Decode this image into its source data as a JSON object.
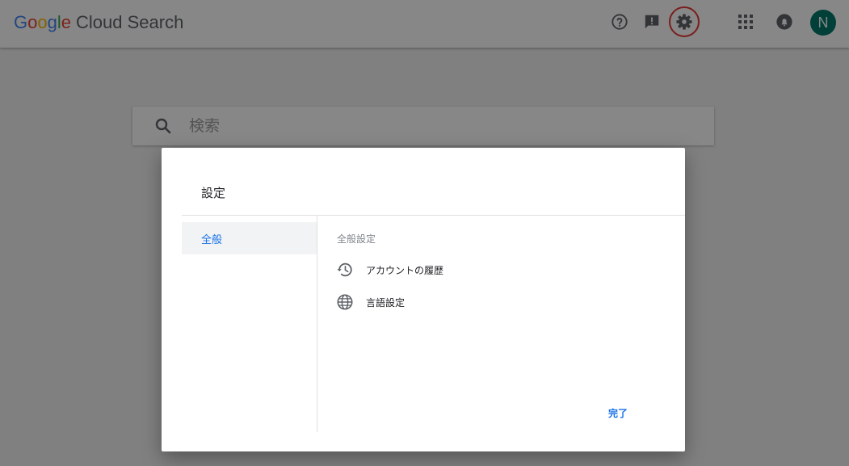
{
  "header": {
    "logo_letters": [
      {
        "char": "G",
        "color": "#4285F4"
      },
      {
        "char": "o",
        "color": "#EA4335"
      },
      {
        "char": "o",
        "color": "#FBBC05"
      },
      {
        "char": "g",
        "color": "#4285F4"
      },
      {
        "char": "l",
        "color": "#34A853"
      },
      {
        "char": "e",
        "color": "#EA4335"
      }
    ],
    "product_name": "Cloud Search",
    "icons": [
      "help-icon",
      "feedback-icon",
      "settings-icon",
      "apps-grid-icon",
      "notifications-icon"
    ],
    "avatar_letter": "N",
    "avatar_color": "#00796b",
    "highlight_color": "#e53935"
  },
  "search": {
    "placeholder": "検索"
  },
  "dialog": {
    "title": "設定",
    "nav_items": [
      {
        "label": "全般",
        "selected": true
      }
    ],
    "section_title": "全般設定",
    "options": [
      {
        "label": "アカウントの履歴",
        "icon": "history-icon"
      },
      {
        "label": "言語設定",
        "icon": "globe-icon"
      }
    ],
    "done_label": "完了"
  },
  "colors": {
    "accent": "#1a73e8",
    "overlay": "rgba(0,0,0,0.47)"
  }
}
